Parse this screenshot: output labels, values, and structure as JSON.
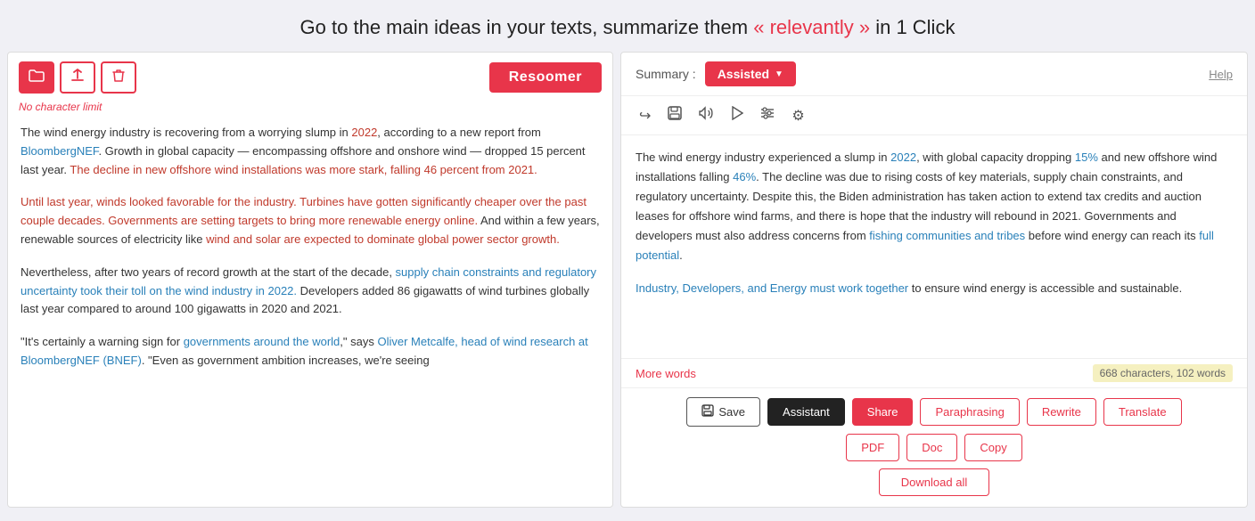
{
  "header": {
    "text_plain": "Go to the main ideas in your texts, summarize them",
    "text_highlight": "« relevantly »",
    "text_end": "in 1 Click"
  },
  "left_panel": {
    "char_limit": "No character limit",
    "resoomer_label": "Resoomer",
    "toolbar": {
      "folder_icon": "📁",
      "upload_icon": "⬆",
      "trash_icon": "🗑"
    },
    "paragraphs": [
      "The wind energy industry is recovering from a worrying slump in 2022, according to a new report from BloombergNEF. Growth in global capacity — encompassing offshore and onshore wind — dropped 15 percent last year. The decline in new offshore wind installations was more stark, falling 46 percent from 2021.",
      "Until last year, winds looked favorable for the industry. Turbines have gotten significantly cheaper over the past couple decades. Governments are setting targets to bring more renewable energy online. And within a few years, renewable sources of electricity like wind and solar are expected to dominate global power sector growth.",
      "Nevertheless, after two years of record growth at the start of the decade, supply chain constraints and regulatory uncertainty took their toll on the wind industry in 2022. Developers added 86 gigawatts of wind turbines globally last year compared to around 100 gigawatts in 2020 and 2021.",
      "\"It's certainly a warning sign for governments around the world,\" says Oliver Metcalfe, head of wind research at BloombergNEF (BNEF). \"Even as government ambition increases, we're seeing"
    ]
  },
  "right_panel": {
    "summary_label": "Summary :",
    "assisted_label": "Assisted",
    "help_label": "Help",
    "icons": {
      "share": "↪",
      "save": "💾",
      "volume": "🔊",
      "play": "▶",
      "sliders": "☰",
      "settings": "⚙"
    },
    "summary_paragraphs": [
      "The wind energy industry experienced a slump in 2022, with global capacity dropping 15% and new offshore wind installations falling 46%. The decline was due to rising costs of key materials, supply chain constraints, and regulatory uncertainty. Despite this, the Biden administration has taken action to extend tax credits and auction leases for offshore wind farms, and there is hope that the industry will rebound in 2021. Governments and developers must also address concerns from fishing communities and tribes before wind energy can reach its full potential.",
      "Industry, Developers, and Energy must work together to ensure wind energy is accessible and sustainable."
    ],
    "more_words": "More words",
    "char_count": "668 characters,  102 words",
    "buttons": {
      "save": "Save",
      "assistant": "Assistant",
      "share": "Share",
      "paraphrasing": "Paraphrasing",
      "rewrite": "Rewrite",
      "translate": "Translate",
      "pdf": "PDF",
      "doc": "Doc",
      "copy": "Copy",
      "download_all": "Download all"
    }
  }
}
